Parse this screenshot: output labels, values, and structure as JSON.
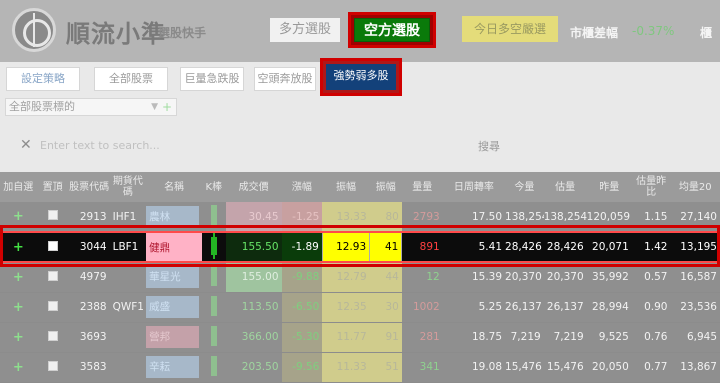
{
  "header": {
    "brand": "順流小準",
    "brand_sub": "選股快手",
    "long_button": "多方選股",
    "short_button": "空方選股",
    "today_button": "今日多空嚴選",
    "market_label": "市櫃差幅",
    "market_value": "-0.37%",
    "market_more": "櫃"
  },
  "toolbar": {
    "settings": "設定策略",
    "all_stocks": "全部股票",
    "giant_drop": "巨量急跌股",
    "empty_rush": "空頭奔放股",
    "strong_weak": "強勢弱多股"
  },
  "filter": {
    "select_value": "全部股票標的"
  },
  "search": {
    "placeholder": "Enter text to search...",
    "button": "搜尋"
  },
  "table": {
    "headers": [
      "加自選",
      "置頂",
      "股票代碼",
      "期貨代碼",
      "名稱",
      "K棒",
      "成交價",
      "漲幅",
      "振幅",
      "振幅",
      "量量",
      "日周轉率",
      "今量",
      "估量",
      "昨量",
      "估量昨比",
      "均量20"
    ],
    "rows": [
      {
        "code": "2913",
        "fut": "IHF1",
        "name": "農林",
        "price": "30.45",
        "chg": "-1.25",
        "amp": "13.33",
        "amp2": "80",
        "vol": "2793",
        "turn": "17.50",
        "today": "138,254",
        "est": "138,254",
        "yest": "120,059",
        "ratio": "1.15",
        "avg20": "27,140"
      },
      {
        "code": "3044",
        "fut": "LBF1",
        "name": "健鼎",
        "price": "155.50",
        "chg": "-1.89",
        "amp": "12.93",
        "amp2": "41",
        "vol": "891",
        "turn": "5.41",
        "today": "28,426",
        "est": "28,426",
        "yest": "20,071",
        "ratio": "1.42",
        "avg20": "13,195"
      },
      {
        "code": "4979",
        "fut": "",
        "name": "華星光",
        "price": "155.00",
        "chg": "-9.88",
        "amp": "12.79",
        "amp2": "44",
        "vol": "12",
        "turn": "15.39",
        "today": "20,370",
        "est": "20,370",
        "yest": "35,992",
        "ratio": "0.57",
        "avg20": "16,587"
      },
      {
        "code": "2388",
        "fut": "QWF1",
        "name": "威盛",
        "price": "113.50",
        "chg": "-6.50",
        "amp": "12.35",
        "amp2": "30",
        "vol": "1002",
        "turn": "5.25",
        "today": "26,137",
        "est": "26,137",
        "yest": "28,994",
        "ratio": "0.90",
        "avg20": "23,536"
      },
      {
        "code": "3693",
        "fut": "",
        "name": "營邦",
        "price": "366.00",
        "chg": "-5.30",
        "amp": "11.77",
        "amp2": "91",
        "vol": "281",
        "turn": "18.75",
        "today": "7,219",
        "est": "7,219",
        "yest": "9,525",
        "ratio": "0.76",
        "avg20": "6,945"
      },
      {
        "code": "3583",
        "fut": "",
        "name": "辛耘",
        "price": "203.50",
        "chg": "-9.56",
        "amp": "11.33",
        "amp2": "51",
        "vol": "341",
        "turn": "19.08",
        "today": "15,476",
        "est": "15,476",
        "yest": "20,050",
        "ratio": "0.77",
        "avg20": "13,867"
      }
    ]
  },
  "colors": {
    "accent_red": "#d00000",
    "short_green": "#0a7a0a",
    "strong_blue": "#13417a",
    "amp_yellow": "#ffff00"
  }
}
